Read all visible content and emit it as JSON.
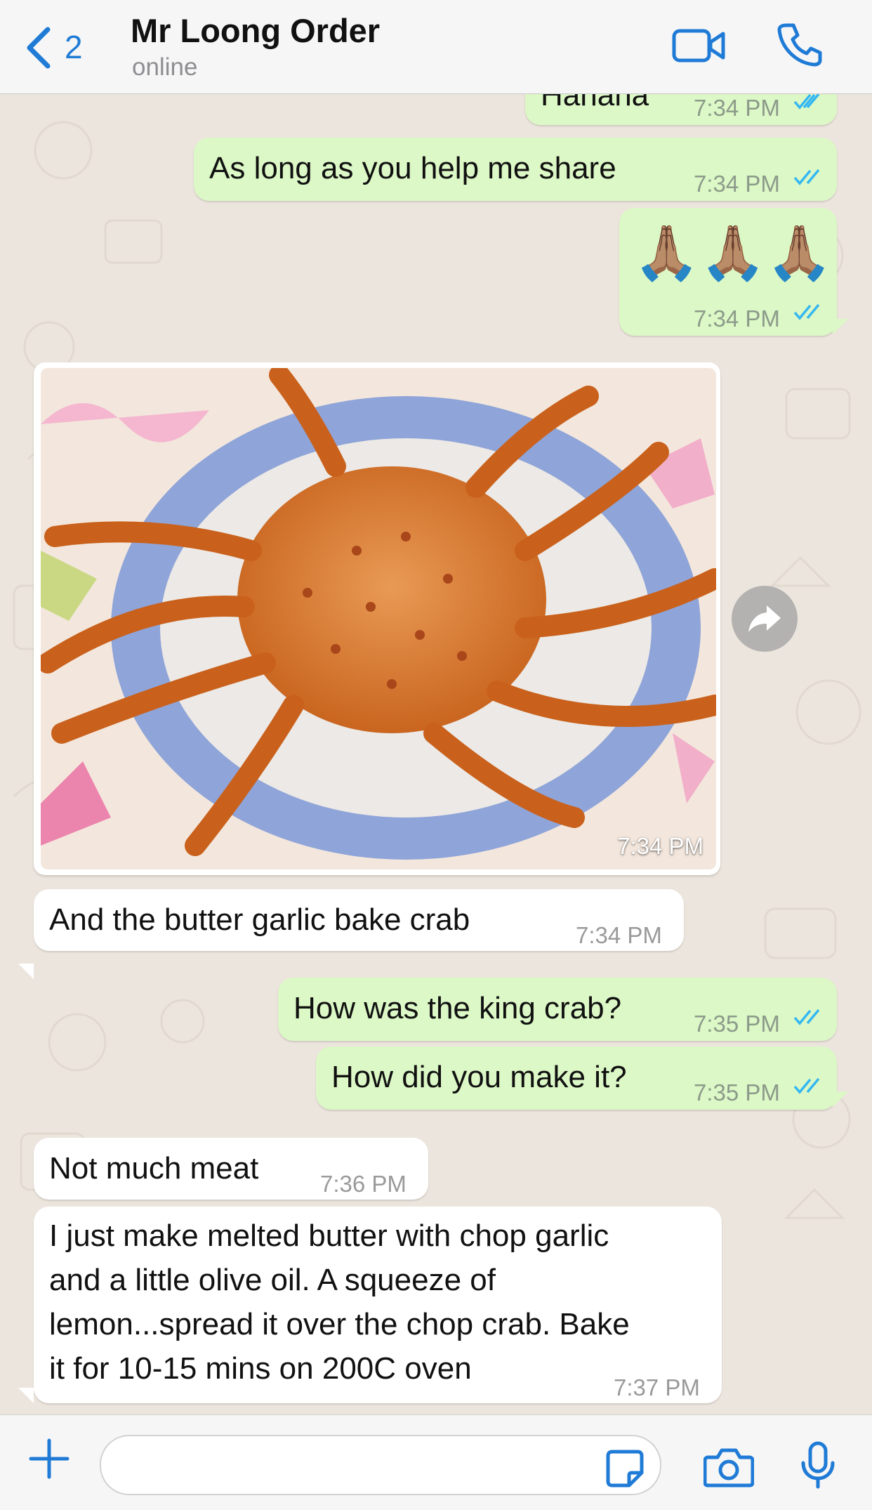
{
  "header": {
    "back_count": "2",
    "title": "Mr Loong Order",
    "status": "online"
  },
  "messages": [
    {
      "id": "m1",
      "direction": "out",
      "text": "Hahaha",
      "time": "7:34 PM",
      "read": true
    },
    {
      "id": "m2",
      "direction": "out",
      "text": "As long as you help me share",
      "time": "7:34 PM",
      "read": true
    },
    {
      "id": "m3",
      "direction": "out",
      "text": "🙏🏽🙏🏽🙏🏽",
      "time": "7:34 PM",
      "read": true
    },
    {
      "id": "m4",
      "direction": "in",
      "type": "image",
      "image": "photo of baked king crab on a blue patterned plate",
      "time": "7:34 PM"
    },
    {
      "id": "m5",
      "direction": "in",
      "text": "And the butter garlic bake crab",
      "time": "7:34 PM"
    },
    {
      "id": "m6",
      "direction": "out",
      "text": "How was the king crab?",
      "time": "7:35 PM",
      "read": true
    },
    {
      "id": "m7",
      "direction": "out",
      "text": "How did you make it?",
      "time": "7:35 PM",
      "read": true
    },
    {
      "id": "m8",
      "direction": "in",
      "text": "Not much meat",
      "time": "7:36 PM"
    },
    {
      "id": "m9",
      "direction": "in",
      "lines": [
        "I just make melted butter with chop garlic",
        "and a little olive oil. A squeeze of",
        "lemon...spread it over the chop crab. Bake",
        "it for 10-15 mins on 200C oven"
      ],
      "time": "7:37 PM"
    }
  ],
  "input": {
    "placeholder": "",
    "value": ""
  },
  "icons": [
    "back-chevron-icon",
    "video-call-icon",
    "phone-icon",
    "forward-icon",
    "plus-icon",
    "sticker-icon",
    "camera-icon",
    "microphone-icon",
    "read-ticks-icon"
  ],
  "colors": {
    "accent": "#1f7bd6",
    "outgoing_bubble": "#dcf8c6",
    "incoming_bubble": "#ffffff",
    "chat_bg": "#ece5dd",
    "read_ticks": "#34b7f1"
  }
}
